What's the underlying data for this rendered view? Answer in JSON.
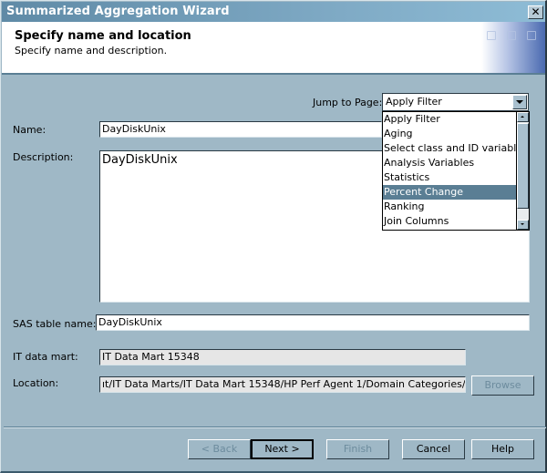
{
  "window": {
    "title": "Summarized Aggregation Wizard",
    "close_label": "✕"
  },
  "header": {
    "title": "Specify name and location",
    "subtitle": "Specify name and description."
  },
  "jump": {
    "label": "Jump to Page:",
    "selected": "Apply Filter",
    "options": [
      "Apply Filter",
      "Aging",
      "Select class and ID variables",
      "Analysis Variables",
      "Statistics",
      "Percent Change",
      "Ranking",
      "Join Columns"
    ],
    "highlighted": "Percent Change"
  },
  "form": {
    "name_label": "Name:",
    "name_value": "DayDiskUnix",
    "description_label": "Description:",
    "description_value": "DayDiskUnix",
    "table_label": "SAS table name:",
    "table_value": "DayDiskUnix",
    "mart_label": "IT data mart:",
    "mart_value": "IT Data Mart 15348",
    "location_label": "Location:",
    "location_value": "ıt/IT Data Marts/IT Data Mart 15348/HP Perf Agent 1/Domain Categories/Disk Unix",
    "browse_label": "Browse"
  },
  "buttons": {
    "back": "< Back",
    "next": "Next >",
    "finish": "Finish",
    "cancel": "Cancel",
    "help": "Help"
  }
}
